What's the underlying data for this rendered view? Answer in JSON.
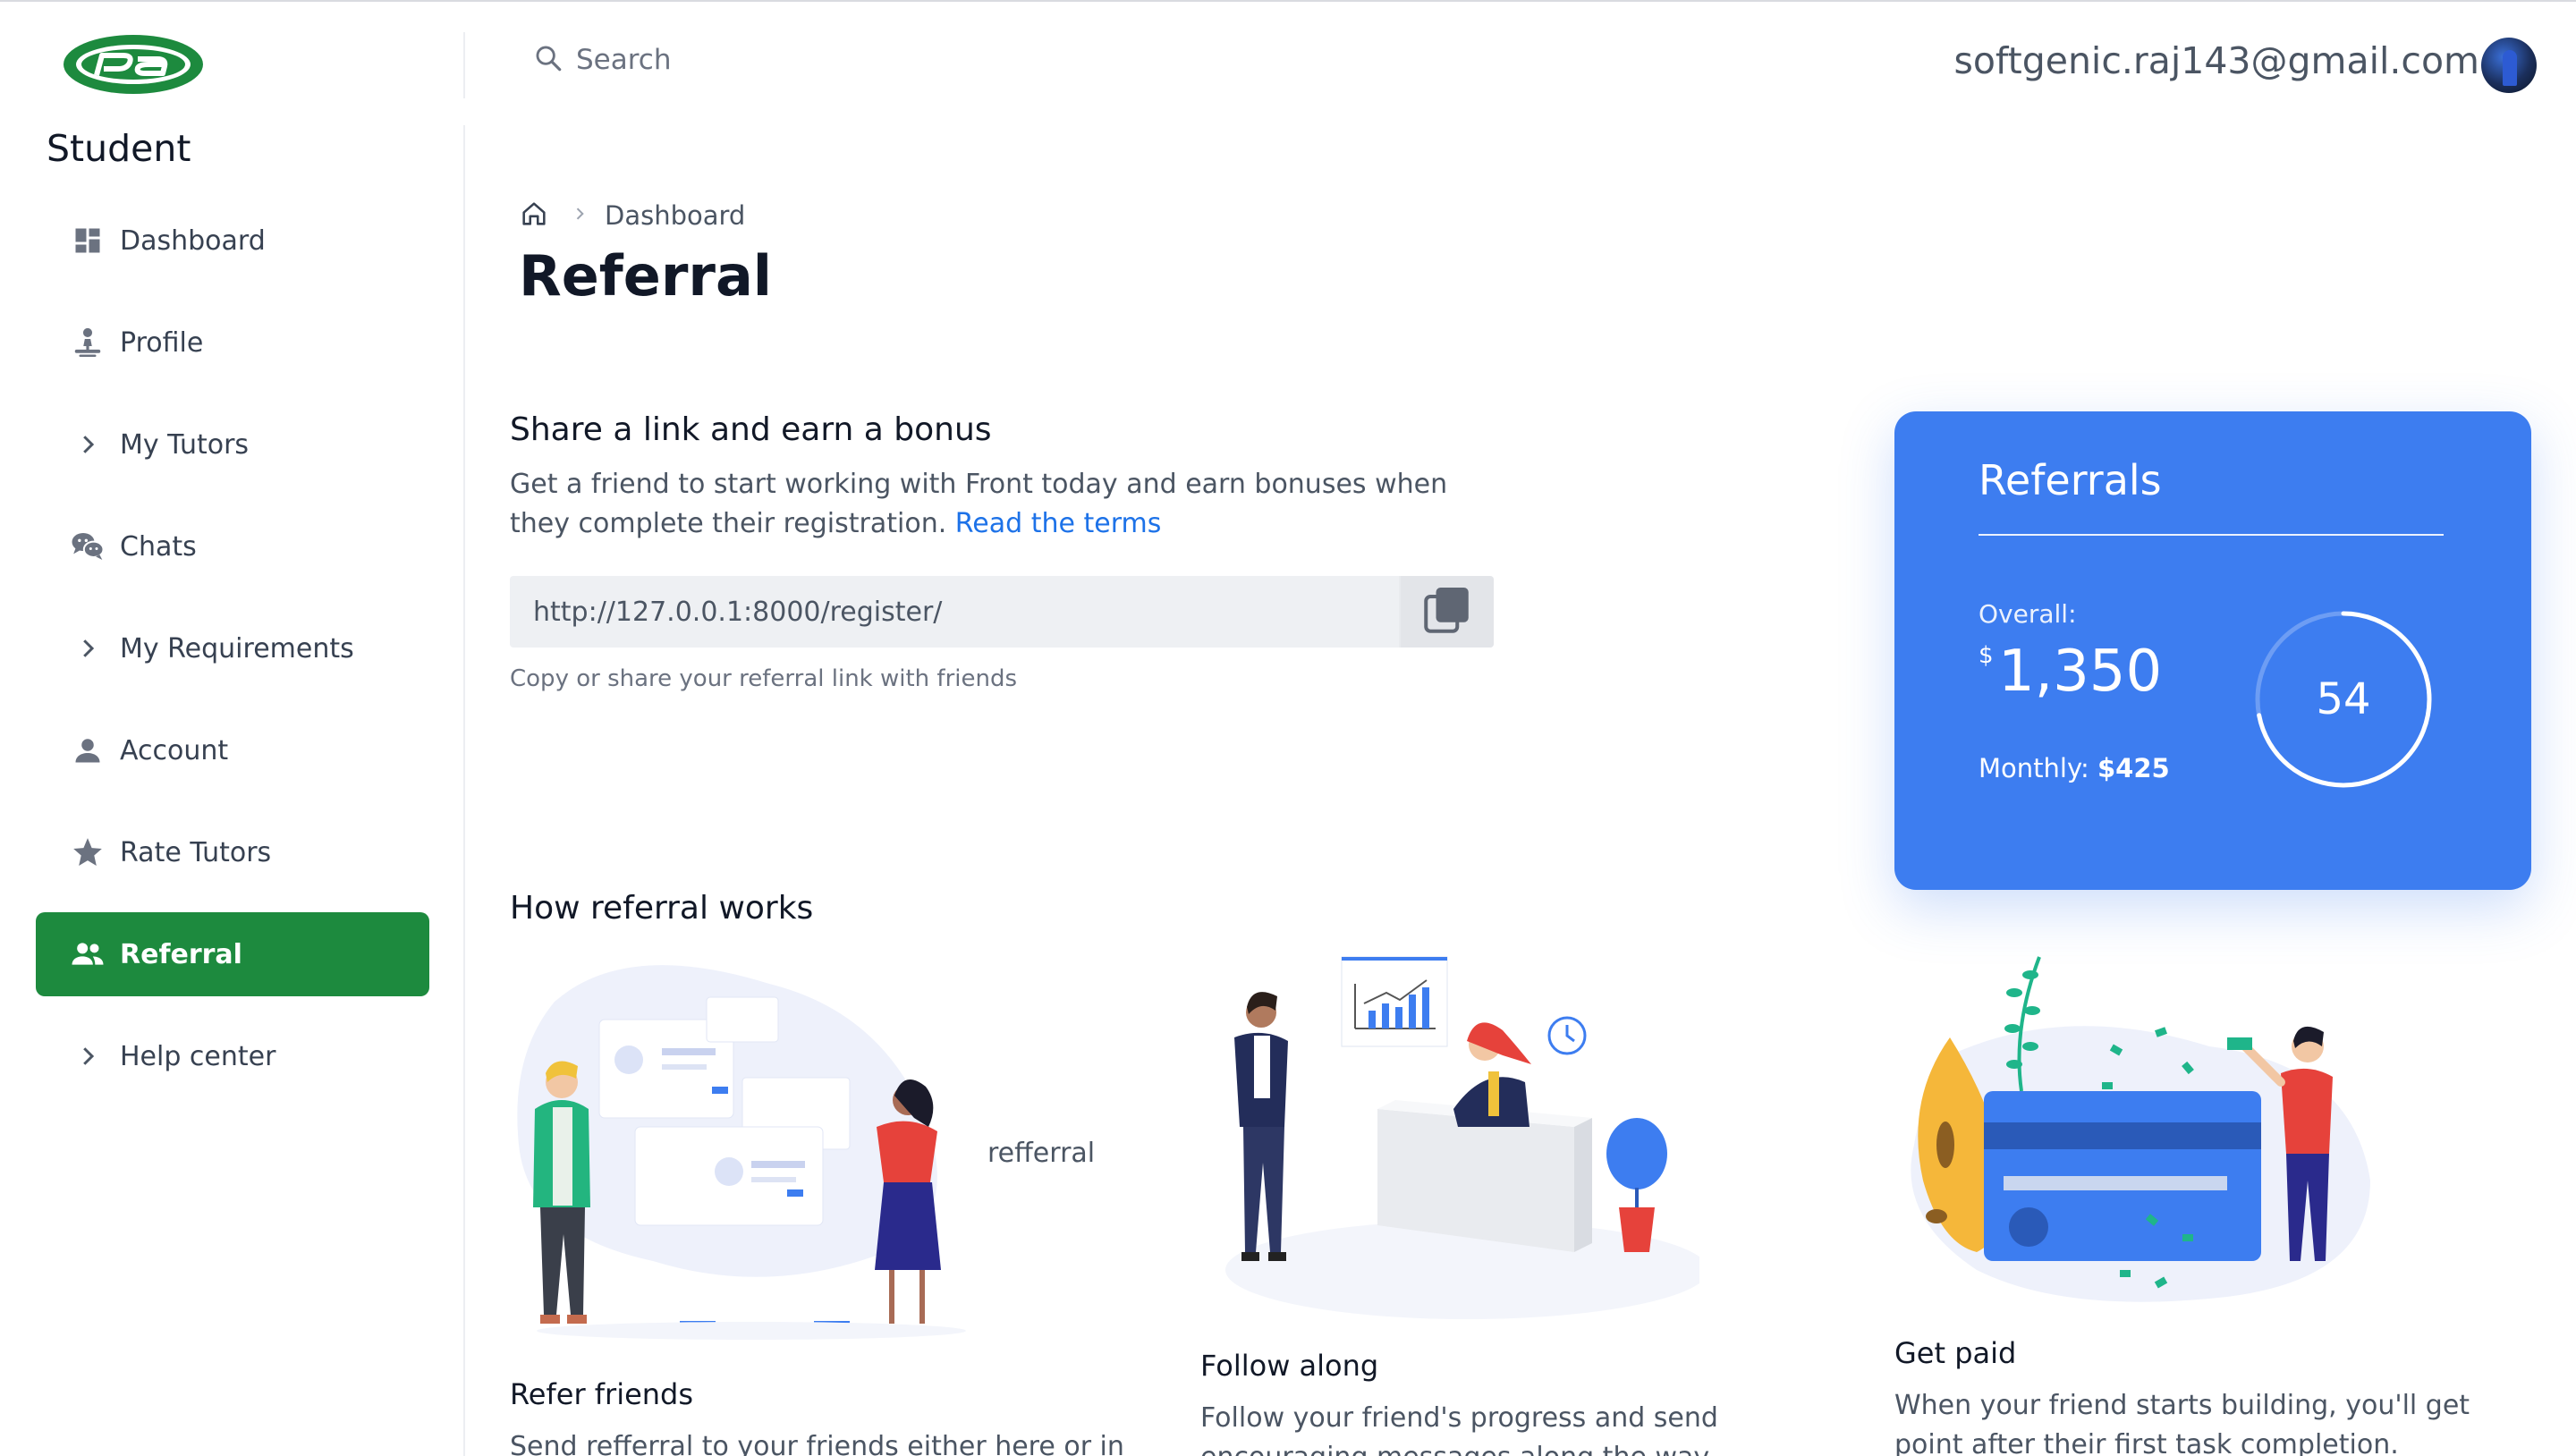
{
  "app": {
    "role": "Student",
    "logo_text": "Pa",
    "brand_color": "#1d8a3e",
    "accent_color": "#3d7df0",
    "link_color": "#1d72e8"
  },
  "header": {
    "search_placeholder": "Search",
    "user_email": "softgenic.raj143@gmail.com"
  },
  "sidebar": {
    "items": [
      {
        "label": "Dashboard",
        "icon": "dashboard-icon",
        "active": false
      },
      {
        "label": "Profile",
        "icon": "profile-icon",
        "active": false
      },
      {
        "label": "My Tutors",
        "icon": "chevron-right-icon",
        "active": false
      },
      {
        "label": "Chats",
        "icon": "chats-icon",
        "active": false
      },
      {
        "label": "My Requirements",
        "icon": "chevron-right-icon",
        "active": false
      },
      {
        "label": "Account",
        "icon": "person-icon",
        "active": false
      },
      {
        "label": "Rate Tutors",
        "icon": "star-icon",
        "active": false
      },
      {
        "label": "Referral",
        "icon": "people-icon",
        "active": true
      },
      {
        "label": "Help center",
        "icon": "chevron-right-icon",
        "active": false
      }
    ]
  },
  "breadcrumb": {
    "home_icon": "home-icon",
    "current": "Dashboard"
  },
  "page": {
    "title": "Referral"
  },
  "share": {
    "title": "Share a link and earn a bonus",
    "description": "Get a friend to start working with Front today and earn bonuses when they complete their registration.",
    "terms_link": "Read the terms",
    "referral_link": "http://127.0.0.1:8000/register/",
    "copy_icon": "copy-icon",
    "hint": "Copy or share your referral link with friends"
  },
  "referrals_card": {
    "title": "Referrals",
    "overall_label": "Overall:",
    "currency": "$",
    "overall_value": "1,350",
    "monthly_label": "Monthly:",
    "monthly_value": "$425",
    "count": "54",
    "ring_progress": 0.72
  },
  "how_it_works": {
    "title": "How referral works",
    "steps": [
      {
        "title": "Refer friends",
        "description": "Send refferral to your friends either here or in your",
        "illustration_label": "refferral"
      },
      {
        "title": "Follow along",
        "description": "Follow your friend's progress and send encouraging messages along the way."
      },
      {
        "title": "Get paid",
        "description": "When your friend starts building, you'll get point after their first task completion."
      }
    ]
  }
}
